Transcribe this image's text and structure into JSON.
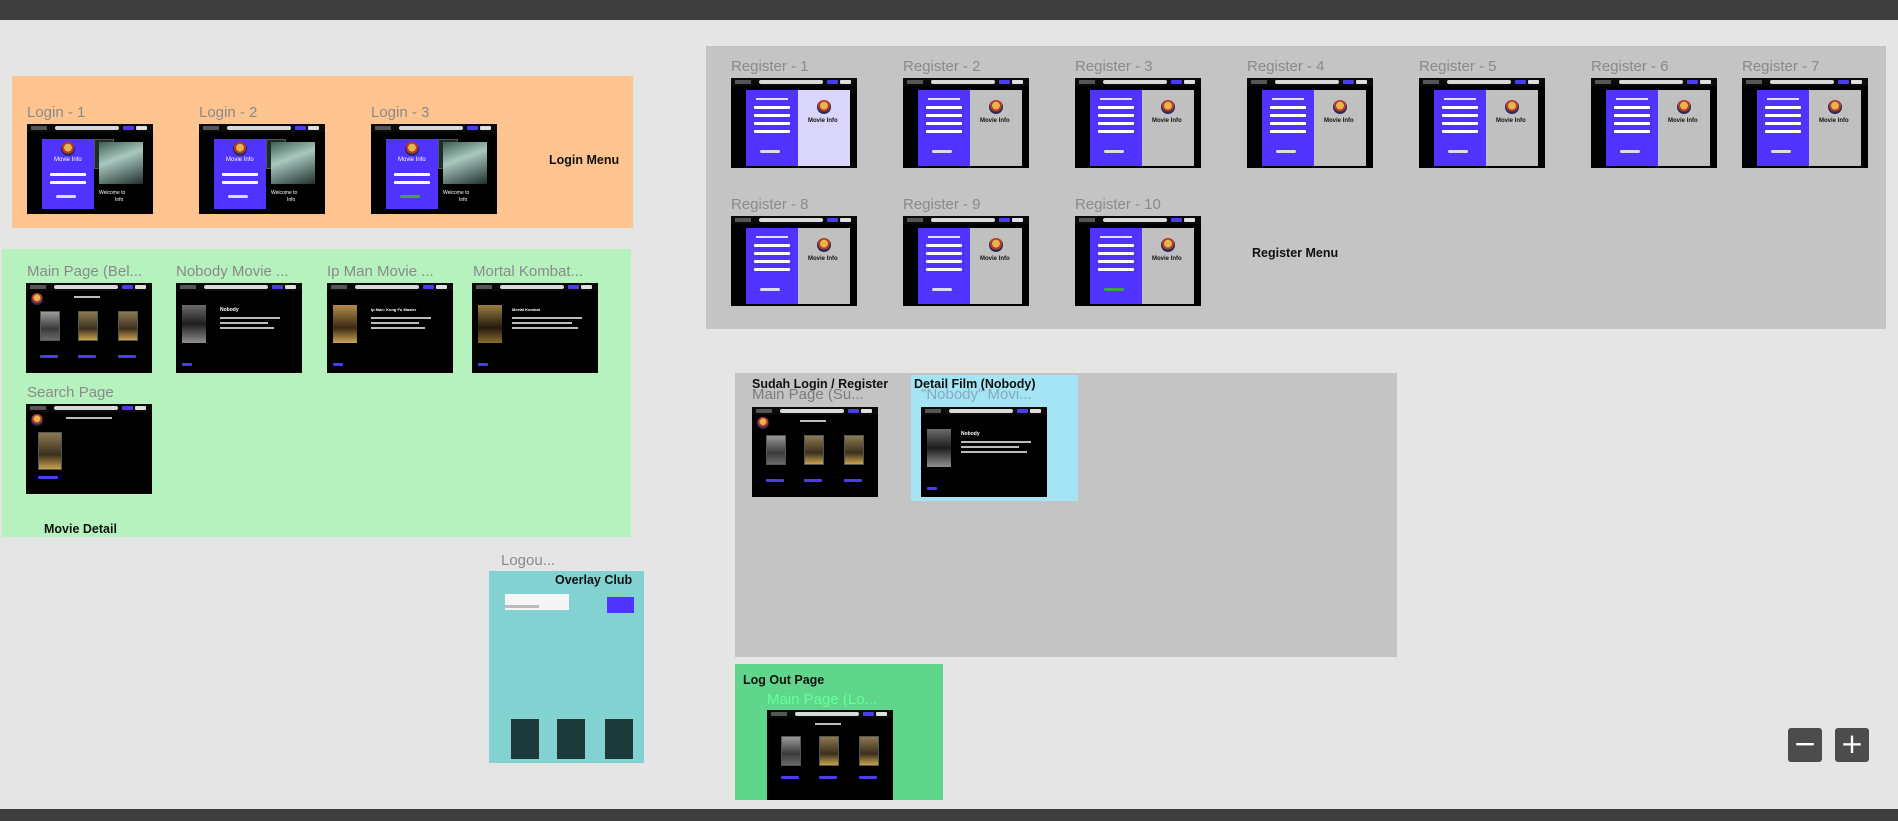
{
  "sections": {
    "login_menu": "Login Menu",
    "movie_detail": "Movie Detail",
    "overlay_club": "Overlay Club",
    "register_menu": "Register Menu",
    "sudah_login": "Sudah Login / Register",
    "detail_film": "Detail Film (Nobody)",
    "log_out_page": "Log Out Page"
  },
  "frames": {
    "login": [
      "Login - 1",
      "Login - 2",
      "Login - 3"
    ],
    "movie": [
      "Main Page (Bel...",
      "Nobody Movie ...",
      "Ip Man Movie ...",
      "Mortal Kombat...",
      "Search Page"
    ],
    "register": [
      "Register - 1",
      "Register - 2",
      "Register - 3",
      "Register - 4",
      "Register - 5",
      "Register - 6",
      "Register - 7",
      "Register - 8",
      "Register - 9",
      "Register - 10"
    ],
    "logout_overlay": "Logou...",
    "sudah_main": "Main Page (Su...",
    "nobody_movie": "\"Nobody\" Movi...",
    "logout_main": "Main Page (Lo..."
  },
  "thumb_text": {
    "movie_info": "Movie Info",
    "welcome": "Welcome to",
    "info": "Info",
    "nobody": "Nobody",
    "ip_man": "Ip Man: Kung Fu Master",
    "mortal": "Mortal Kombat"
  },
  "controls": {
    "zoom_out": "−",
    "zoom_in": "+"
  }
}
